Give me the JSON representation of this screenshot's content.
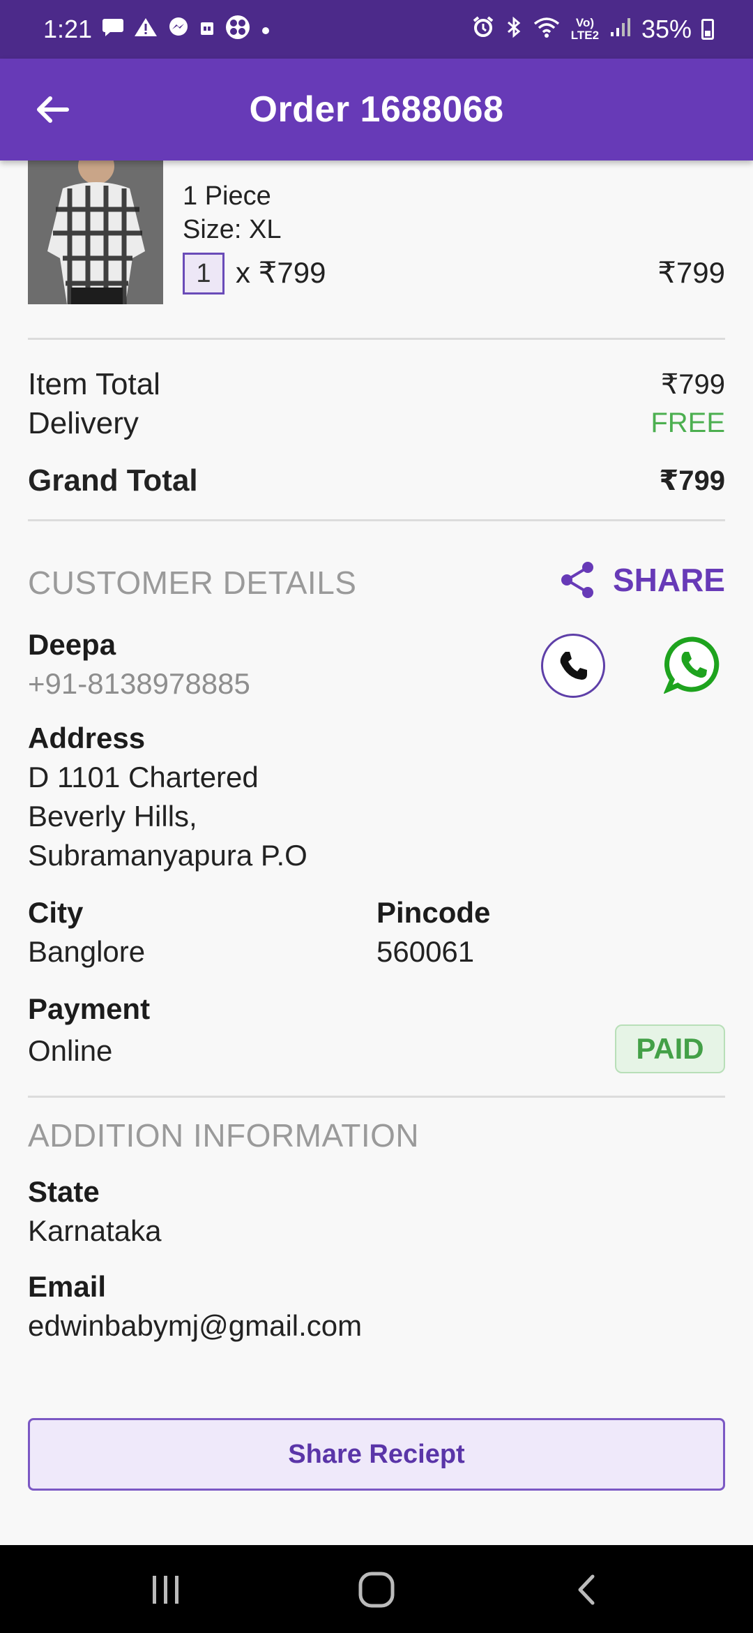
{
  "status_bar": {
    "time": "1:21",
    "battery": "35%",
    "left_icons": [
      "chat-icon",
      "warning-icon",
      "messenger-icon",
      "sim-icon",
      "app-icon",
      "dot-icon"
    ],
    "right_icons": [
      "alarm-icon",
      "bluetooth-icon",
      "wifi-icon",
      "volte-icon",
      "signal-icon",
      "battery-icon"
    ],
    "network_label": "Vo) LTE2"
  },
  "app_bar": {
    "title": "Order 1688068",
    "color": "#673ab7"
  },
  "product": {
    "pieces": "1 Piece",
    "size": "Size: XL",
    "quantity": "1",
    "unit_price": "x ₹799",
    "line_total": "₹799"
  },
  "totals": {
    "item_total_label": "Item Total",
    "item_total_value": "₹799",
    "delivery_label": "Delivery",
    "delivery_value": "FREE",
    "grand_total_label": "Grand Total",
    "grand_total_value": "₹799"
  },
  "customer": {
    "section_title": "CUSTOMER DETAILS",
    "share_label": "SHARE",
    "name": "Deepa",
    "phone": "+91-8138978885",
    "address_label": "Address",
    "address_lines": [
      "D 1101 Chartered",
      "Beverly Hills,",
      "Subramanyapura P.O"
    ],
    "city_label": "City",
    "city": "Banglore",
    "pincode_label": "Pincode",
    "pincode": "560061",
    "payment_label": "Payment",
    "payment": "Online",
    "payment_status": "PAID"
  },
  "additional": {
    "section_title": "ADDITION INFORMATION",
    "state_label": "State",
    "state": "Karnataka",
    "email_label": "Email",
    "email": "edwinbabymj@gmail.com"
  },
  "actions": {
    "share_receipt": "Share Reciept"
  },
  "colors": {
    "accent": "#673ab7",
    "status_bar": "#4c2a8a",
    "paid": "#43a047",
    "whatsapp": "#1ea31e"
  }
}
